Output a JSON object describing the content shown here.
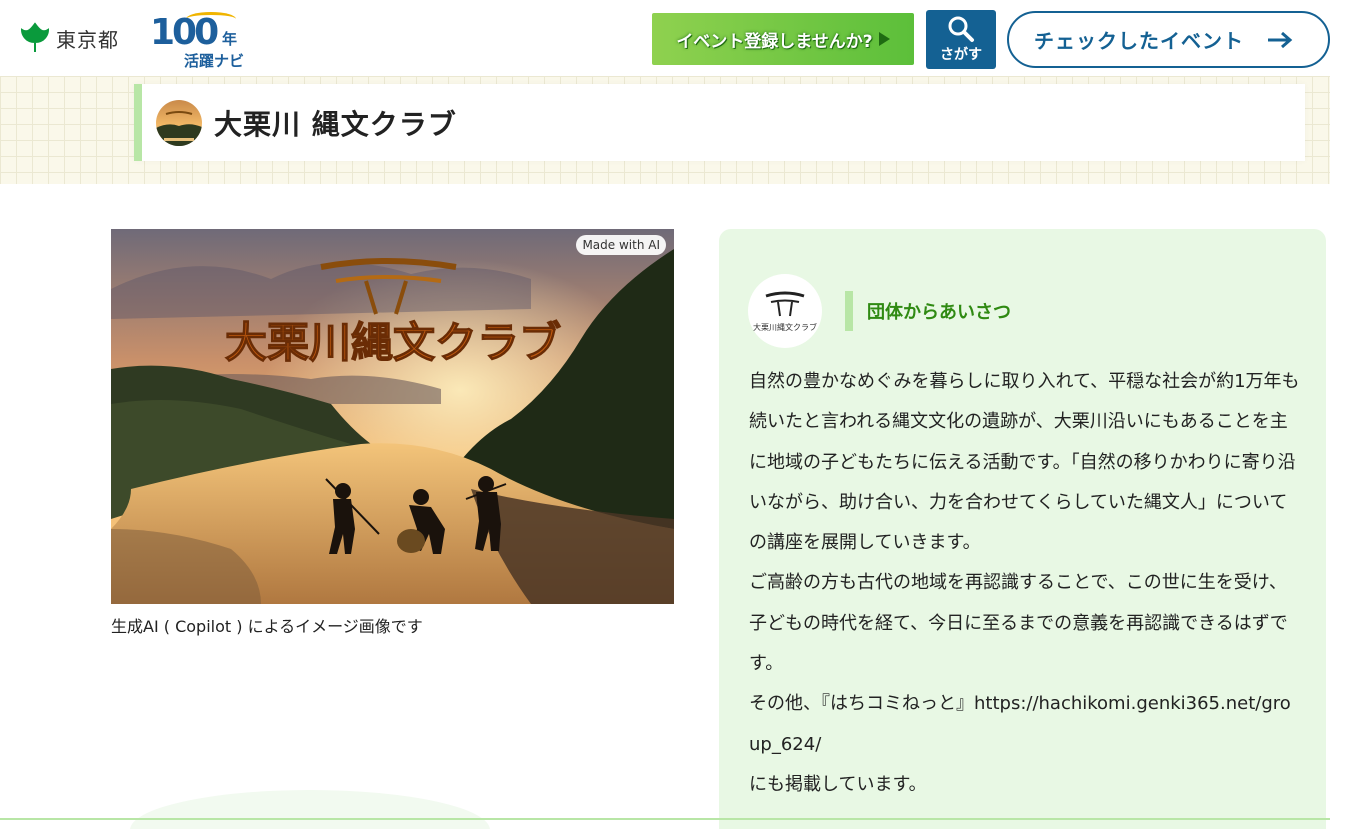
{
  "header": {
    "tokyo_label": "東京都",
    "logo_number": "100",
    "logo_year": "年",
    "logo_sub": "活躍ナビ",
    "event_register_label": "イベント登録しませんか?",
    "search_label": "さがす",
    "checked_events_label": "チェックしたイベント"
  },
  "title": {
    "text": "大栗川 縄文クラブ"
  },
  "main_image": {
    "badge": "Made with AI",
    "overlay_title": "大栗川縄文クラブ",
    "caption": "生成AI ( Copilot ) によるイメージ画像です"
  },
  "greeting": {
    "avatar_text": "大栗川縄文クラブ",
    "heading": "団体からあいさつ",
    "paragraph1": "自然の豊かなめぐみを暮らしに取り入れて、平穏な社会が約1万年も続いたと言われる縄文文化の遺跡が、大栗川沿いにもあることを主に地域の子どもたちに伝える活動です。「自然の移りかわりに寄り沿いながら、助け合い、力を合わせてくらしていた縄文人」についての講座を展開していきます。",
    "paragraph2": "ご高齢の方も古代の地域を再認識することで、この世に生を受け、子どもの時代を経て、今日に至るまでの意義を再認識できるはずです。",
    "paragraph3": "その他、『はちコミねっと』https://hachikomi.genki365.net/group_624/",
    "paragraph4": "にも掲載しています。"
  },
  "colors": {
    "brand_blue": "#146193",
    "accent_green": "#b8e6a6",
    "panel_green": "#e8f8e4",
    "heading_green": "#2f8a12"
  }
}
